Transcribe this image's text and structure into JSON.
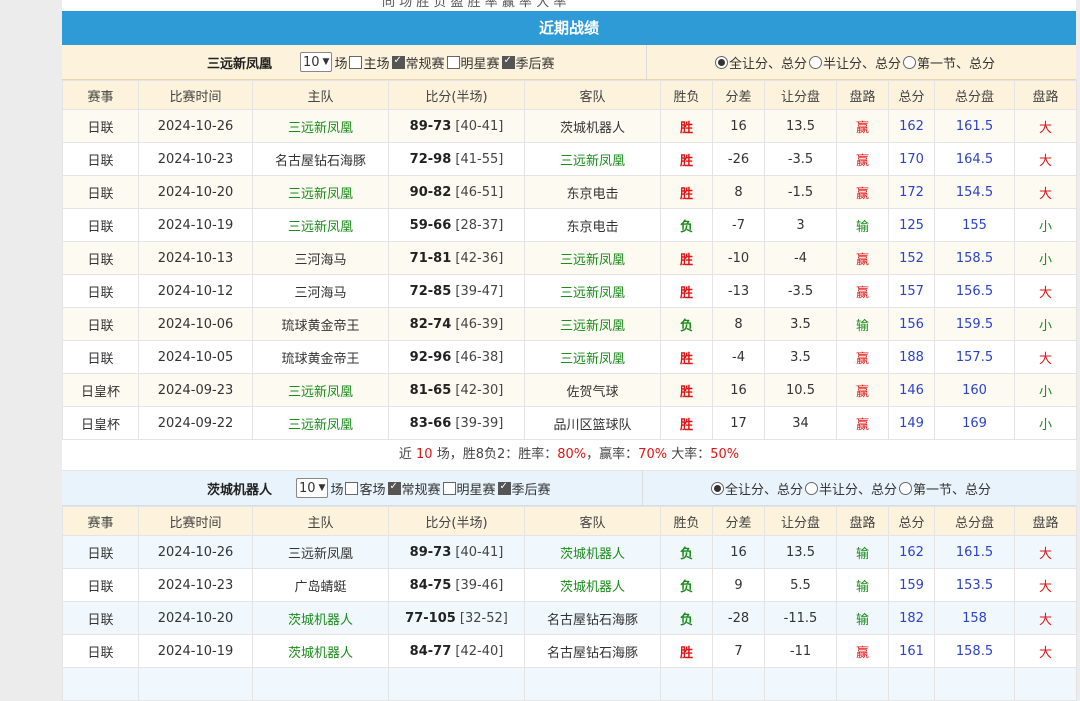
{
  "colors": {
    "green": "#1a8c1a",
    "red": "#e01515",
    "blue": "#2b43c9",
    "header_blue": "#2e9ad6"
  },
  "top_text": "同 场 胜 负 盈 胜 率 赢 率 大 率",
  "title": "近期战绩",
  "team1": {
    "name": "三远新凤凰",
    "count": "10",
    "count_unit": "场",
    "filters": [
      {
        "label": "主场",
        "checked": false
      },
      {
        "label": "常规赛",
        "checked": true
      },
      {
        "label": "明星赛",
        "checked": false
      },
      {
        "label": "季后赛",
        "checked": true
      }
    ],
    "radios": [
      {
        "label": "全让分、总分",
        "checked": true
      },
      {
        "label": "半让分、总分",
        "checked": false
      },
      {
        "label": "第一节、总分",
        "checked": false
      }
    ],
    "headers": [
      "赛事",
      "比赛时间",
      "主队",
      "比分(半场)",
      "客队",
      "胜负",
      "分差",
      "让分盘",
      "盘路",
      "总分",
      "总分盘",
      "盘路"
    ],
    "rows": [
      {
        "league": "日联",
        "date": "2024-10-26",
        "home": "三远新凤凰",
        "home_hl": true,
        "score": "89-73",
        "half": "[40-41]",
        "away": "茨城机器人",
        "away_hl": false,
        "wl": "胜",
        "wl_c": "r",
        "diff": "16",
        "hcp": "13.5",
        "hres": "赢",
        "hres_c": "r",
        "total": "162",
        "tline": "161.5",
        "ou": "大",
        "ou_c": "r"
      },
      {
        "league": "日联",
        "date": "2024-10-23",
        "home": "名古屋钻石海豚",
        "home_hl": false,
        "score": "72-98",
        "half": "[41-55]",
        "away": "三远新凤凰",
        "away_hl": true,
        "wl": "胜",
        "wl_c": "r",
        "diff": "-26",
        "hcp": "-3.5",
        "hres": "赢",
        "hres_c": "r",
        "total": "170",
        "tline": "164.5",
        "ou": "大",
        "ou_c": "r"
      },
      {
        "league": "日联",
        "date": "2024-10-20",
        "home": "三远新凤凰",
        "home_hl": true,
        "score": "90-82",
        "half": "[46-51]",
        "away": "东京电击",
        "away_hl": false,
        "wl": "胜",
        "wl_c": "r",
        "diff": "8",
        "hcp": "-1.5",
        "hres": "赢",
        "hres_c": "r",
        "total": "172",
        "tline": "154.5",
        "ou": "大",
        "ou_c": "r"
      },
      {
        "league": "日联",
        "date": "2024-10-19",
        "home": "三远新凤凰",
        "home_hl": true,
        "score": "59-66",
        "half": "[28-37]",
        "away": "东京电击",
        "away_hl": false,
        "wl": "负",
        "wl_c": "g",
        "diff": "-7",
        "hcp": "3",
        "hres": "输",
        "hres_c": "g",
        "total": "125",
        "tline": "155",
        "ou": "小",
        "ou_c": "g"
      },
      {
        "league": "日联",
        "date": "2024-10-13",
        "home": "三河海马",
        "home_hl": false,
        "score": "71-81",
        "half": "[42-36]",
        "away": "三远新凤凰",
        "away_hl": true,
        "wl": "胜",
        "wl_c": "r",
        "diff": "-10",
        "hcp": "-4",
        "hres": "赢",
        "hres_c": "r",
        "total": "152",
        "tline": "158.5",
        "ou": "小",
        "ou_c": "g"
      },
      {
        "league": "日联",
        "date": "2024-10-12",
        "home": "三河海马",
        "home_hl": false,
        "score": "72-85",
        "half": "[39-47]",
        "away": "三远新凤凰",
        "away_hl": true,
        "wl": "胜",
        "wl_c": "r",
        "diff": "-13",
        "hcp": "-3.5",
        "hres": "赢",
        "hres_c": "r",
        "total": "157",
        "tline": "156.5",
        "ou": "大",
        "ou_c": "r"
      },
      {
        "league": "日联",
        "date": "2024-10-06",
        "home": "琉球黄金帝王",
        "home_hl": false,
        "score": "82-74",
        "half": "[46-39]",
        "away": "三远新凤凰",
        "away_hl": true,
        "wl": "负",
        "wl_c": "g",
        "diff": "8",
        "hcp": "3.5",
        "hres": "输",
        "hres_c": "g",
        "total": "156",
        "tline": "159.5",
        "ou": "小",
        "ou_c": "g"
      },
      {
        "league": "日联",
        "date": "2024-10-05",
        "home": "琉球黄金帝王",
        "home_hl": false,
        "score": "92-96",
        "half": "[46-38]",
        "away": "三远新凤凰",
        "away_hl": true,
        "wl": "胜",
        "wl_c": "r",
        "diff": "-4",
        "hcp": "3.5",
        "hres": "赢",
        "hres_c": "r",
        "total": "188",
        "tline": "157.5",
        "ou": "大",
        "ou_c": "r"
      },
      {
        "league": "日皇杯",
        "date": "2024-09-23",
        "home": "三远新凤凰",
        "home_hl": true,
        "score": "81-65",
        "half": "[42-30]",
        "away": "佐贺气球",
        "away_hl": false,
        "wl": "胜",
        "wl_c": "r",
        "diff": "16",
        "hcp": "10.5",
        "hres": "赢",
        "hres_c": "r",
        "total": "146",
        "tline": "160",
        "ou": "小",
        "ou_c": "g"
      },
      {
        "league": "日皇杯",
        "date": "2024-09-22",
        "home": "三远新凤凰",
        "home_hl": true,
        "score": "83-66",
        "half": "[39-39]",
        "away": "品川区篮球队",
        "away_hl": false,
        "wl": "胜",
        "wl_c": "r",
        "diff": "17",
        "hcp": "34",
        "hres": "赢",
        "hres_c": "r",
        "total": "149",
        "tline": "169",
        "ou": "小",
        "ou_c": "g"
      }
    ],
    "summary": {
      "p1": "近 ",
      "n": "10",
      "p2": " 场，胜8负2：胜率：",
      "win": "80%",
      "p3": "，赢率：",
      "cover": "70%",
      "p4": " 大率：",
      "over": "50%"
    }
  },
  "team2": {
    "name": "茨城机器人",
    "count": "10",
    "count_unit": "场",
    "filters": [
      {
        "label": "客场",
        "checked": false
      },
      {
        "label": "常规赛",
        "checked": true
      },
      {
        "label": "明星赛",
        "checked": false
      },
      {
        "label": "季后赛",
        "checked": true
      }
    ],
    "radios": [
      {
        "label": "全让分、总分",
        "checked": true
      },
      {
        "label": "半让分、总分",
        "checked": false
      },
      {
        "label": "第一节、总分",
        "checked": false
      }
    ],
    "headers": [
      "赛事",
      "比赛时间",
      "主队",
      "比分(半场)",
      "客队",
      "胜负",
      "分差",
      "让分盘",
      "盘路",
      "总分",
      "总分盘",
      "盘路"
    ],
    "rows": [
      {
        "league": "日联",
        "date": "2024-10-26",
        "home": "三远新凤凰",
        "home_hl": false,
        "score": "89-73",
        "half": "[40-41]",
        "away": "茨城机器人",
        "away_hl": true,
        "wl": "负",
        "wl_c": "g",
        "diff": "16",
        "hcp": "13.5",
        "hres": "输",
        "hres_c": "g",
        "total": "162",
        "tline": "161.5",
        "ou": "大",
        "ou_c": "r"
      },
      {
        "league": "日联",
        "date": "2024-10-23",
        "home": "广岛蜻蜓",
        "home_hl": false,
        "score": "84-75",
        "half": "[39-46]",
        "away": "茨城机器人",
        "away_hl": true,
        "wl": "负",
        "wl_c": "g",
        "diff": "9",
        "hcp": "5.5",
        "hres": "输",
        "hres_c": "g",
        "total": "159",
        "tline": "153.5",
        "ou": "大",
        "ou_c": "r"
      },
      {
        "league": "日联",
        "date": "2024-10-20",
        "home": "茨城机器人",
        "home_hl": true,
        "score": "77-105",
        "half": "[32-52]",
        "away": "名古屋钻石海豚",
        "away_hl": false,
        "wl": "负",
        "wl_c": "g",
        "diff": "-28",
        "hcp": "-11.5",
        "hres": "输",
        "hres_c": "g",
        "total": "182",
        "tline": "158",
        "ou": "大",
        "ou_c": "r"
      },
      {
        "league": "日联",
        "date": "2024-10-19",
        "home": "茨城机器人",
        "home_hl": true,
        "score": "84-77",
        "half": "[42-40]",
        "away": "名古屋钻石海豚",
        "away_hl": false,
        "wl": "胜",
        "wl_c": "r",
        "diff": "7",
        "hcp": "-11",
        "hres": "赢",
        "hres_c": "r",
        "total": "161",
        "tline": "158.5",
        "ou": "大",
        "ou_c": "r"
      },
      {
        "league": "",
        "date": "",
        "home": "",
        "home_hl": false,
        "score": "",
        "half": "",
        "away": "",
        "away_hl": false,
        "wl": "",
        "wl_c": "r",
        "diff": "",
        "hcp": "",
        "hres": "",
        "hres_c": "r",
        "total": "",
        "tline": "",
        "ou": "",
        "ou_c": "r"
      }
    ]
  }
}
